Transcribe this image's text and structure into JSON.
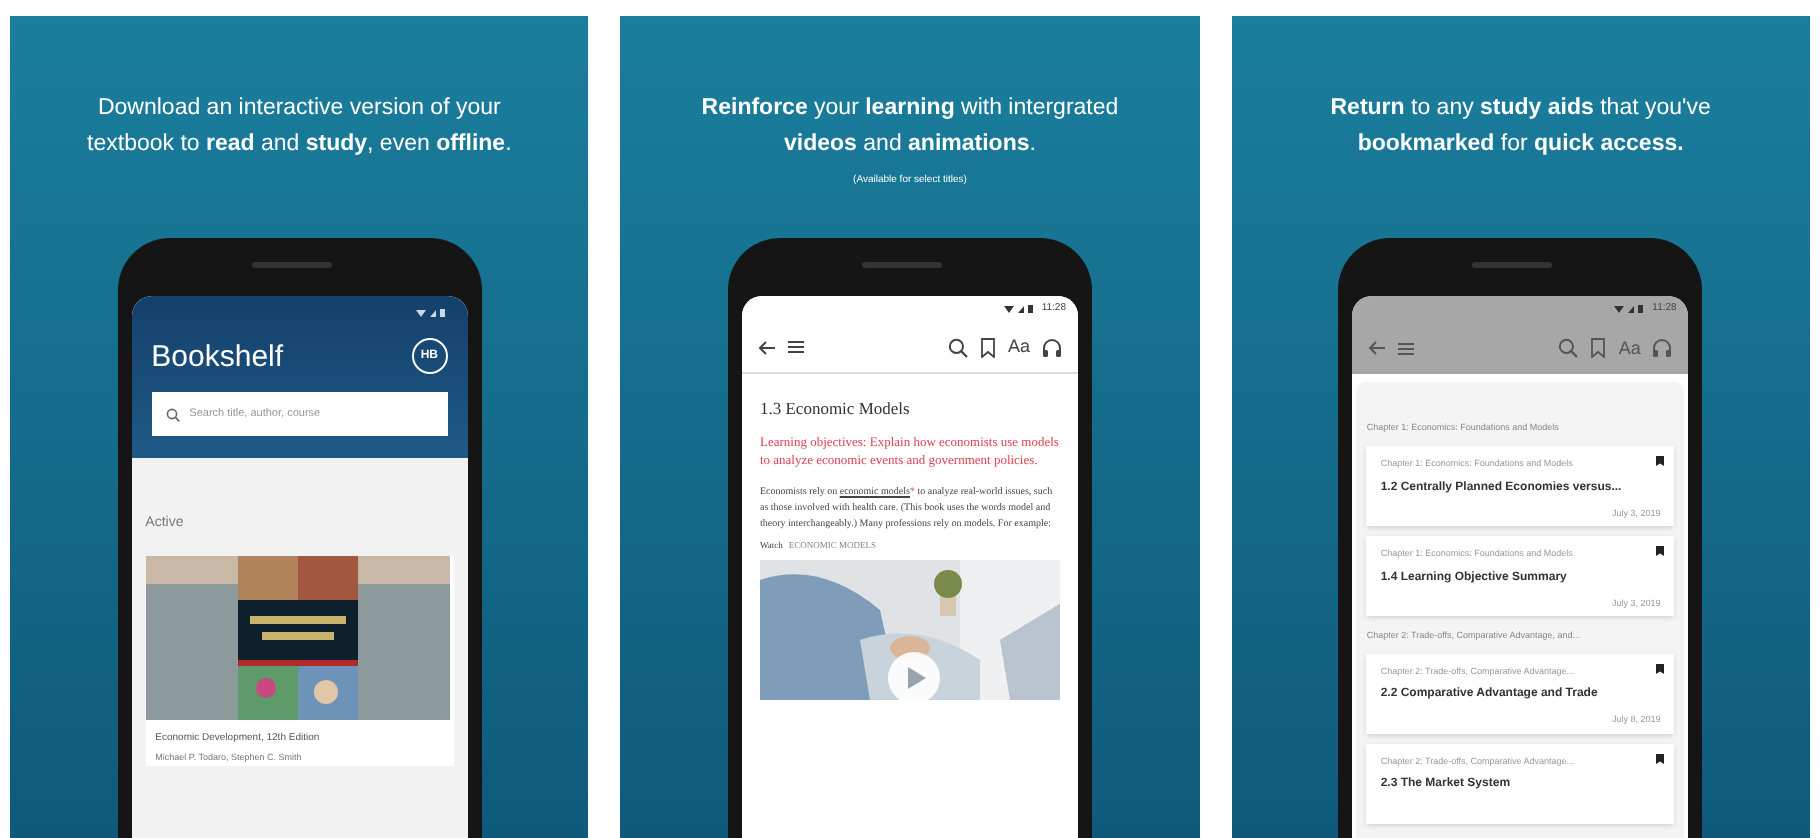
{
  "panels": [
    {
      "kind": "bookshelf",
      "caption": "Download an interactive version of your textbook to **read** and **study**, even **offline**.",
      "screen": {
        "title": "Bookshelf",
        "avatar": "HB",
        "search": {
          "placeholder": "Search title, author, course"
        },
        "section": "Active",
        "book": {
          "title": "Economic Development, 12th Edition",
          "authors": "Michael P. Todaro, Stephen C. Smith"
        }
      }
    },
    {
      "kind": "reader",
      "caption": "**Reinforce** your **learning** with intergrated **videos** and **animations**.",
      "note": "(Available for select titles)",
      "screen": {
        "time": "11:28",
        "font_button": "Aa",
        "heading": "1.3 Economic Models",
        "objective": "Learning objectives:  Explain how economists use models to analyze economic events and government policies.",
        "paragraph": [
          {
            "kind": "text",
            "text": "Economists rely on "
          },
          {
            "kind": "link",
            "text": "economic models"
          },
          {
            "kind": "mark",
            "text": "*"
          },
          {
            "kind": "text",
            "text": " to analyze real-world issues, such as those involved with health care. (This book uses the words model and theory interchangeably.) Many professions rely on models. For example:"
          }
        ],
        "watch": {
          "label": "Watch",
          "title": "ECONOMIC MODELS"
        }
      }
    },
    {
      "kind": "bookmarks",
      "caption": "**Return** to any **study aids** that you've **bookmarked** for **quick access.**",
      "screen": {
        "time": "11:28",
        "font_button": "Aa",
        "groups": [
          {
            "title": "Chapter 1: Economics: Foundations and Models",
            "items": [
              {
                "chapter": "Chapter 1: Economics: Foundations and Models",
                "title": "1.2 Centrally Planned Economies versus...",
                "date": "July 3, 2019"
              },
              {
                "chapter": "Chapter 1: Economics: Foundations and Models",
                "title": "1.4 Learning Objective Summary",
                "date": "July 3, 2019"
              }
            ]
          },
          {
            "title": "Chapter 2: Trade-offs, Comparative Advantage, and...",
            "items": [
              {
                "chapter": "Chapter 2: Trade-offs, Comparative Advantage...",
                "title": "2.2 Comparative Advantage and Trade",
                "date": "July 8, 2019"
              },
              {
                "chapter": "Chapter 2: Trade-offs, Comparative Advantage...",
                "title": "2.3 The Market System"
              }
            ]
          }
        ]
      }
    }
  ]
}
